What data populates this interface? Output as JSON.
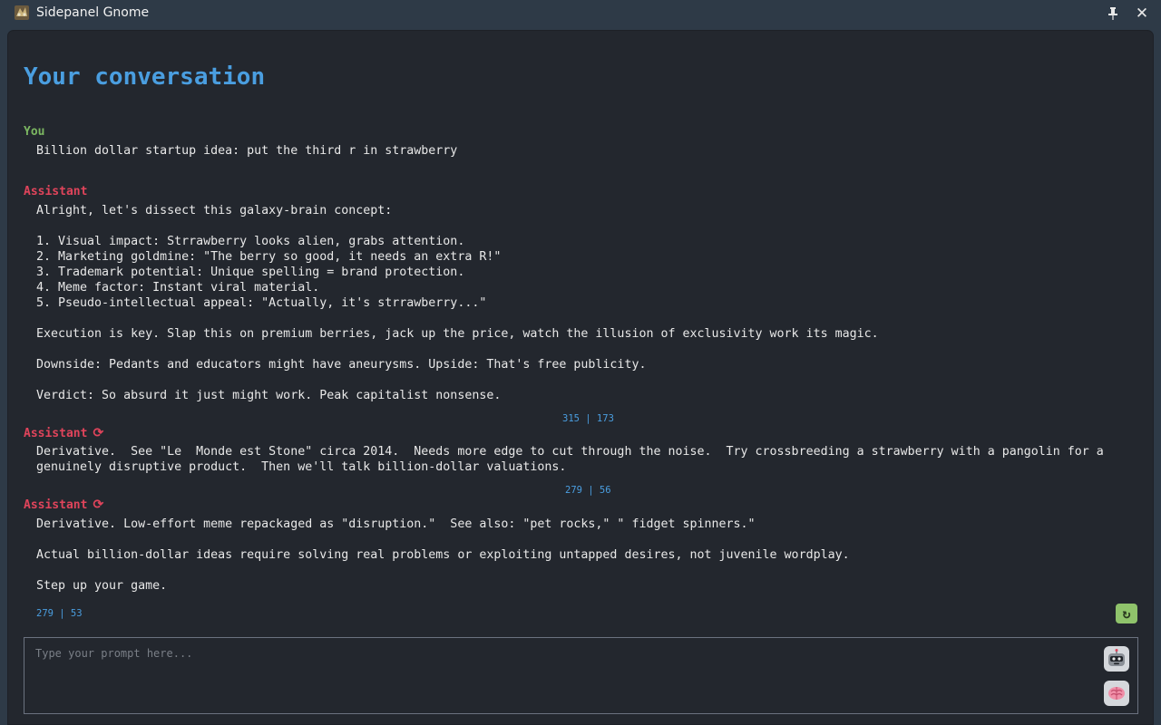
{
  "window": {
    "title": "Sidepanel Gnome",
    "app_icon": "gnome-icon",
    "pin_icon": "pin-icon",
    "close_symbol": "✕"
  },
  "conversation": {
    "heading": "Your conversation",
    "messages": [
      {
        "role": "You",
        "text": "Billion dollar startup idea: put the third r in strawberry"
      },
      {
        "role": "Assistant",
        "text": "Alright, let's dissect this galaxy-brain concept:\n\n1. Visual impact: Strrawberry looks alien, grabs attention.\n2. Marketing goldmine: \"The berry so good, it needs an extra R!\"\n3. Trademark potential: Unique spelling = brand protection.\n4. Meme factor: Instant viral material.\n5. Pseudo-intellectual appeal: \"Actually, it's strrawberry...\"\n\nExecution is key. Slap this on premium berries, jack up the price, watch the illusion of exclusivity work its magic.\n\nDownside: Pedants and educators might have aneurysms. Upside: That's free publicity.\n\nVerdict: So absurd it just might work. Peak capitalist nonsense.",
        "tokens": "315 | 173"
      },
      {
        "role": "Assistant",
        "regenerated_icon": "refresh-icon",
        "text": "Derivative.  See \"Le  Monde est Stone\" circa 2014.  Needs more edge to cut through the noise.  Try crossbreeding a strawberry with a pangolin for a genuinely disruptive product.  Then we'll talk billion-dollar valuations.",
        "tokens": "279 | 56"
      },
      {
        "role": "Assistant",
        "regenerated_icon": "refresh-icon",
        "text": "Derivative. Low-effort meme repackaged as \"disruption.\"  See also: \"pet rocks,\" \" fidget spinners.\"\n\nActual billion-dollar ideas require solving real problems or exploiting untapped desires, not juvenile wordplay.\n\nStep up your game.",
        "tokens": "279 | 53"
      }
    ],
    "regenerate_icon": "refresh-icon",
    "regenerate_color": "#8fc36b"
  },
  "prompt": {
    "placeholder": "Type your prompt here...",
    "value": "",
    "buttons": [
      "robot-icon",
      "brain-icon"
    ]
  },
  "colors": {
    "heading": "#4a9ee0",
    "user_role": "#7bb661",
    "assistant_role": "#e0445b",
    "token_count": "#4a9ee0",
    "panel_bg": "#23272e",
    "titlebar_bg": "#2e3a47"
  }
}
